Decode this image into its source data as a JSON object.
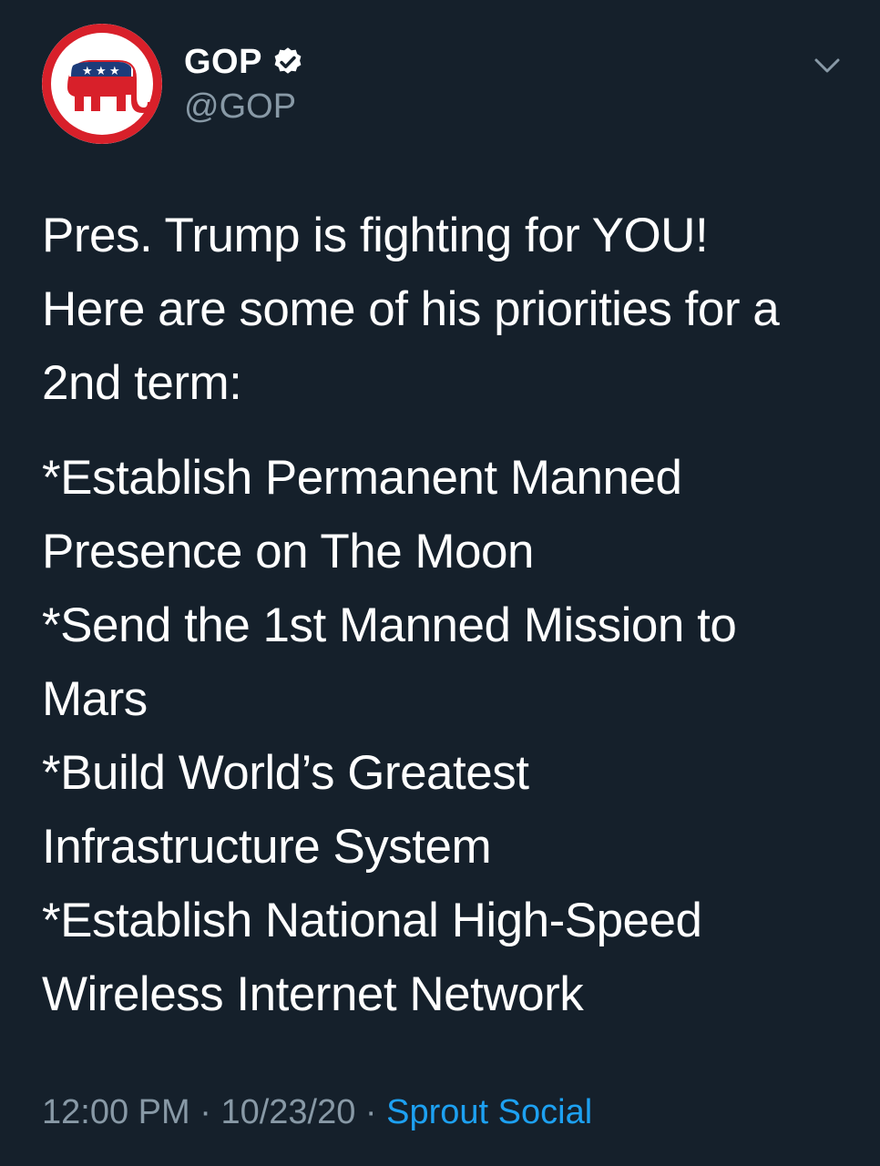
{
  "author": {
    "display_name": "GOP",
    "handle": "@GOP",
    "avatar_icon": "gop-elephant-logo",
    "verified_icon": "verified-badge-icon"
  },
  "tweet": {
    "intro_lines": [
      "Pres. Trump is fighting for YOU!",
      "Here are some of his priorities for a",
      "2nd term:"
    ],
    "list_lines": [
      "*Establish Permanent Manned",
      "Presence on The Moon",
      "*Send the 1st Manned Mission to",
      "Mars",
      "*Build World’s Greatest",
      "Infrastructure System",
      "*Establish National High-Speed",
      "Wireless Internet Network"
    ]
  },
  "meta": {
    "time": "12:00 PM",
    "separator": "·",
    "date": "10/23/20",
    "source": "Sprout Social"
  },
  "colors": {
    "background": "#15202b",
    "text": "#ffffff",
    "secondary": "#8899a6",
    "link": "#1da1f2",
    "gop_red": "#d8202a"
  }
}
